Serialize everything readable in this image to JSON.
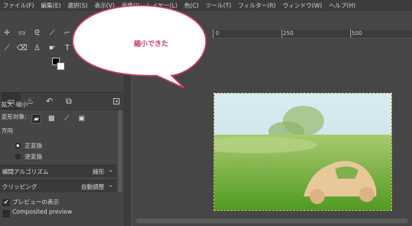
{
  "menu": [
    "ファイル(F)",
    "編集(E)",
    "選択(S)",
    "表示(V)",
    "画像(I)",
    "レイヤー(L)",
    "色(C)",
    "ツール(T)",
    "フィルター(R)",
    "ウィンドウ(W)",
    "ヘルプ(H)"
  ],
  "speech_bubble": "縮小できた",
  "options": {
    "title": "拡大･縮小",
    "transform_target_label": "変形対象:",
    "direction_label": "方向",
    "direction_normal": "正変換",
    "direction_reverse": "逆変換",
    "interpolation_label": "補間アルゴリズム",
    "interpolation_value": "線形",
    "clipping_label": "クリッピング",
    "clipping_value": "自動調整",
    "preview_label": "プレビューの表示",
    "composited_label": "Composited preview"
  },
  "ruler": {
    "t0": "0",
    "t250": "250",
    "t500": "500"
  },
  "colors": {
    "bubble_border": "#c8386e",
    "bubble_text": "#c8386e",
    "selection": "#d8d85a"
  }
}
